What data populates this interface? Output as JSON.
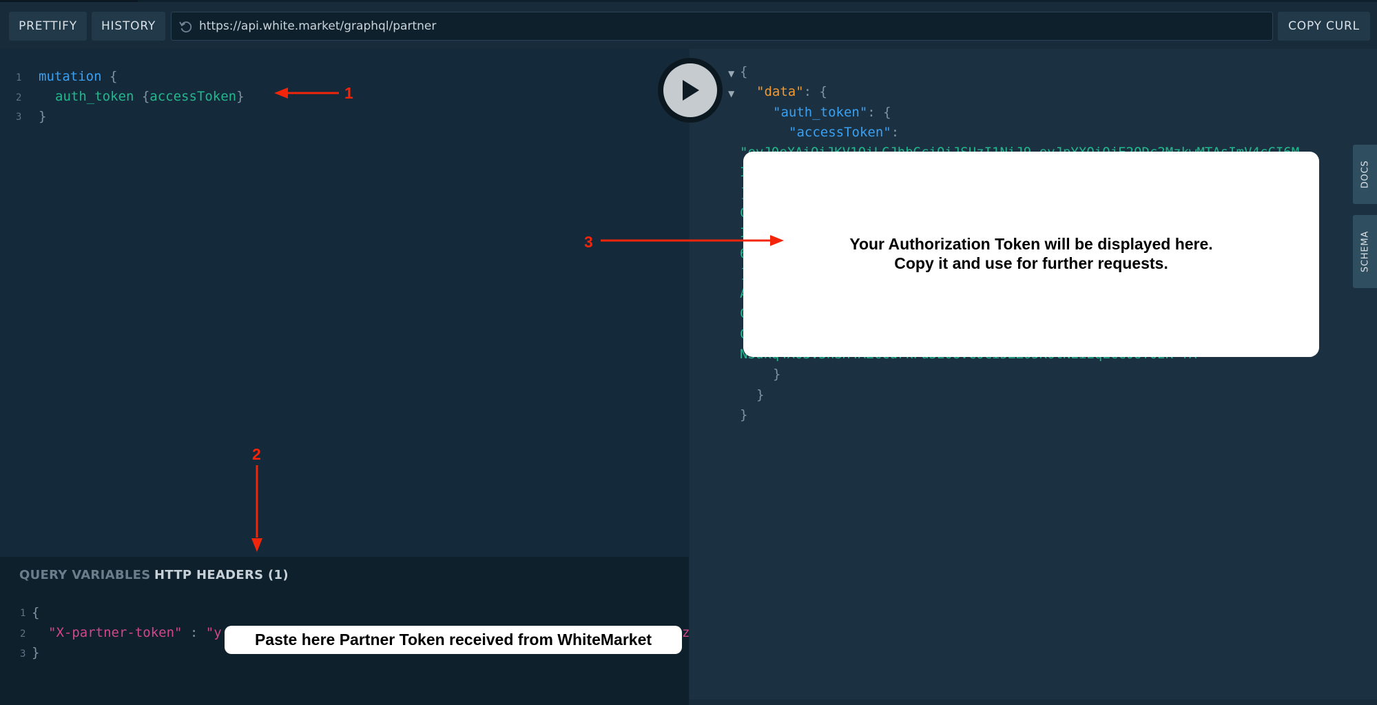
{
  "toolbar": {
    "prettify": "PRETTIFY",
    "history": "HISTORY",
    "url": "https://api.white.market/graphql/partner",
    "copy_curl": "COPY CURL"
  },
  "query_editor": {
    "line_numbers": [
      "1",
      "2",
      "3"
    ],
    "line1_keyword": "mutation",
    "line1_brace": "{",
    "line2_field": "auth_token",
    "line2_open": "{",
    "line2_subfield": "accessToken",
    "line2_close": "}",
    "line3_brace": "}"
  },
  "bottom_panel": {
    "tab_query_variables": "QUERY VARIABLES",
    "tab_http_headers": "HTTP HEADERS (1)",
    "line_numbers": [
      "1",
      "2",
      "3"
    ],
    "open_brace": "{",
    "header_key": "\"X-partner-token\"",
    "colon": " : ",
    "header_value_visible": "\"y",
    "header_value_tail": "z",
    "close_brace": "}"
  },
  "result": {
    "open_brace": "{",
    "data_key": "\"data\"",
    "auth_token_key": "\"auth_token\"",
    "access_token_key": "\"accessToken\"",
    "token_line_first": "\"eyJ0eXAiOiJKV1QiLCJhbGciOiJSUzI1NiJ9.eyJpYXQiOjE2ODc2MzkwMTAsImV4cCI6M",
    "token_line_last": "NSukq4X03V3hSH4AZcCurkFu3E08VCoCi5ZZ65K6tNEiEqLcC0UT02K-fA",
    "token_line_starts": [
      "I",
      "]",
      "C",
      "I",
      "6",
      "]",
      "A",
      "C",
      "C"
    ],
    "close_inner": "}",
    "close_data": "}",
    "close_root": "}"
  },
  "side_tabs": {
    "docs": "DOCS",
    "schema": "SCHEMA"
  },
  "annotations": {
    "num1": "1",
    "num2": "2",
    "num3": "3",
    "token_message_line1": "Your Authorization Token will be displayed here.",
    "token_message_line2": "Copy it and use for further requests.",
    "paste_message": "Paste here Partner Token received from WhiteMarket",
    "arrow_color": "#f2250a"
  },
  "icons": {
    "reload": "reload-icon",
    "play": "play-icon",
    "collapse": "collapse-triangle-icon"
  },
  "colors": {
    "background": "#172b3a",
    "editor": "#14293a",
    "result_panel": "#1b3142",
    "keyword": "#3aa0f2",
    "field": "#22b78d",
    "string": "#d0478a",
    "json_key": "#f29a2e"
  }
}
